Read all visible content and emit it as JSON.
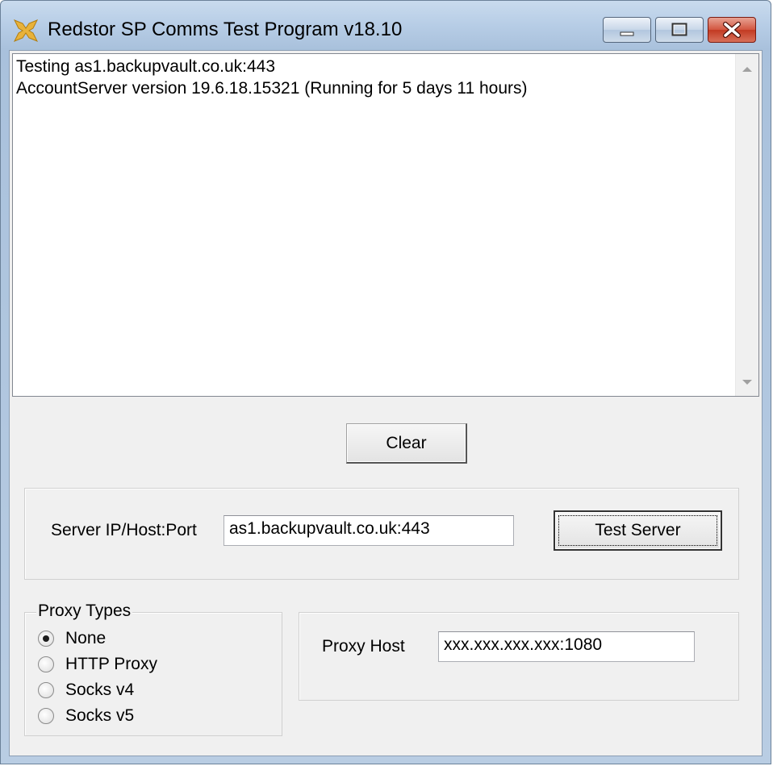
{
  "window": {
    "title": "Redstor SP Comms Test Program v18.10",
    "icon": "redstor-app-icon"
  },
  "log": {
    "lines": "Testing as1.backupvault.co.uk:443\nAccountServer version 19.6.18.15321 (Running for 5 days 11 hours)"
  },
  "buttons": {
    "clear": "Clear",
    "test_server": "Test Server"
  },
  "server": {
    "label": "Server IP/Host:Port",
    "value": "as1.backupvault.co.uk:443"
  },
  "proxy_types": {
    "legend": "Proxy Types",
    "options": [
      {
        "label": "None",
        "selected": true
      },
      {
        "label": "HTTP Proxy",
        "selected": false
      },
      {
        "label": "Socks v4",
        "selected": false
      },
      {
        "label": "Socks v5",
        "selected": false
      }
    ]
  },
  "proxy_host": {
    "label": "Proxy Host",
    "value": "xxx.xxx.xxx.xxx:1080"
  },
  "colors": {
    "close_button": "#c23a22",
    "title_bar": "#b7cde6",
    "client_bg": "#f0f0f0"
  }
}
